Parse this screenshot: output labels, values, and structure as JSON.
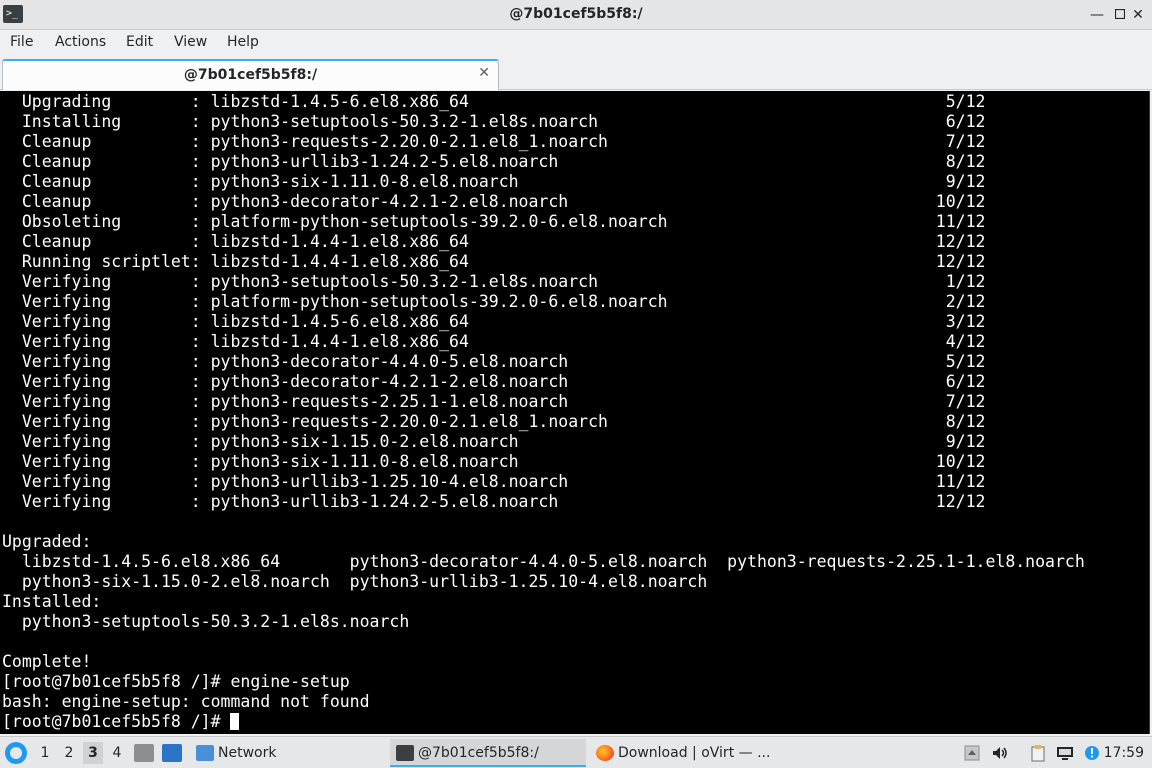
{
  "window": {
    "title": "@7b01cef5b5f8:/"
  },
  "menubar": {
    "items": [
      "File",
      "Actions",
      "Edit",
      "View",
      "Help"
    ]
  },
  "tabs": [
    {
      "label": "@7b01cef5b5f8:/"
    }
  ],
  "terminal": {
    "lines": [
      "  Upgrading        : libzstd-1.4.5-6.el8.x86_64                                                5/12",
      "  Installing       : python3-setuptools-50.3.2-1.el8s.noarch                                   6/12",
      "  Cleanup          : python3-requests-2.20.0-2.1.el8_1.noarch                                  7/12",
      "  Cleanup          : python3-urllib3-1.24.2-5.el8.noarch                                       8/12",
      "  Cleanup          : python3-six-1.11.0-8.el8.noarch                                           9/12",
      "  Cleanup          : python3-decorator-4.2.1-2.el8.noarch                                     10/12",
      "  Obsoleting       : platform-python-setuptools-39.2.0-6.el8.noarch                           11/12",
      "  Cleanup          : libzstd-1.4.4-1.el8.x86_64                                               12/12",
      "  Running scriptlet: libzstd-1.4.4-1.el8.x86_64                                               12/12",
      "  Verifying        : python3-setuptools-50.3.2-1.el8s.noarch                                   1/12",
      "  Verifying        : platform-python-setuptools-39.2.0-6.el8.noarch                            2/12",
      "  Verifying        : libzstd-1.4.5-6.el8.x86_64                                                3/12",
      "  Verifying        : libzstd-1.4.4-1.el8.x86_64                                                4/12",
      "  Verifying        : python3-decorator-4.4.0-5.el8.noarch                                      5/12",
      "  Verifying        : python3-decorator-4.2.1-2.el8.noarch                                      6/12",
      "  Verifying        : python3-requests-2.25.1-1.el8.noarch                                      7/12",
      "  Verifying        : python3-requests-2.20.0-2.1.el8_1.noarch                                  8/12",
      "  Verifying        : python3-six-1.15.0-2.el8.noarch                                           9/12",
      "  Verifying        : python3-six-1.11.0-8.el8.noarch                                          10/12",
      "  Verifying        : python3-urllib3-1.25.10-4.el8.noarch                                     11/12",
      "  Verifying        : python3-urllib3-1.24.2-5.el8.noarch                                      12/12",
      "",
      "Upgraded:",
      "  libzstd-1.4.5-6.el8.x86_64       python3-decorator-4.4.0-5.el8.noarch  python3-requests-2.25.1-1.el8.noarch",
      "  python3-six-1.15.0-2.el8.noarch  python3-urllib3-1.25.10-4.el8.noarch",
      "Installed:",
      "  python3-setuptools-50.3.2-1.el8s.noarch",
      "",
      "Complete!",
      "[root@7b01cef5b5f8 /]# engine-setup",
      "bash: engine-setup: command not found"
    ],
    "prompt": "[root@7b01cef5b5f8 /]# "
  },
  "taskbar": {
    "workspaces": [
      "1",
      "2",
      "3",
      "4"
    ],
    "active_workspace": "3",
    "tasks": [
      {
        "label": "Network"
      },
      {
        "label": "@7b01cef5b5f8:/"
      },
      {
        "label": "Download | oVirt — ..."
      }
    ],
    "clock": "17:59"
  },
  "colors": {
    "accent": "#3daee9",
    "terminal_bg": "#000000",
    "terminal_fg": "#ffffff"
  }
}
